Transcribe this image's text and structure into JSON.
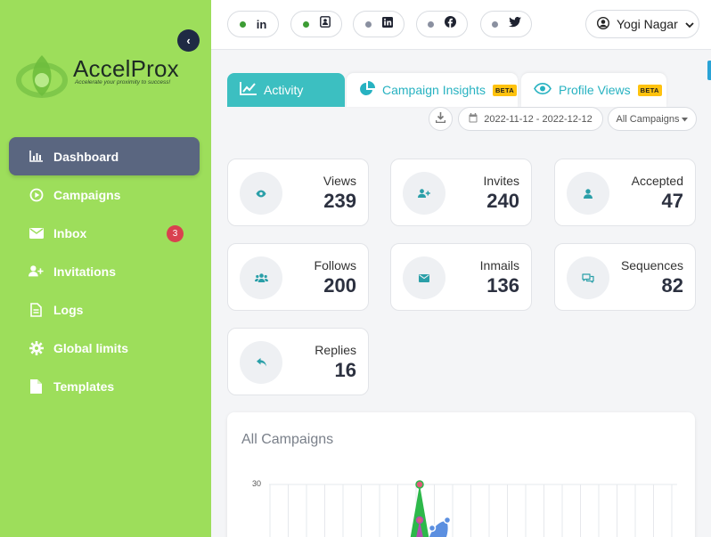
{
  "sidebar": {
    "brand": {
      "name": "AccelProx",
      "tagline": "Accelerate your proximity to success!"
    },
    "items": [
      {
        "label": "Dashboard",
        "icon": "bar-chart-icon",
        "active": true
      },
      {
        "label": "Campaigns",
        "icon": "play-circle-icon"
      },
      {
        "label": "Inbox",
        "icon": "envelope-icon",
        "badge": "3"
      },
      {
        "label": "Invitations",
        "icon": "user-plus-icon"
      },
      {
        "label": "Logs",
        "icon": "file-icon"
      },
      {
        "label": "Global limits",
        "icon": "gear-icon"
      },
      {
        "label": "Templates",
        "icon": "document-icon"
      }
    ]
  },
  "topbar": {
    "accounts": [
      {
        "icon": "linkedin-text-icon",
        "status": "#3c9c34"
      },
      {
        "icon": "contact-card-icon",
        "status": "#3c9c34"
      },
      {
        "icon": "linkedin-square-icon",
        "status": "#8a90a0"
      },
      {
        "icon": "facebook-icon",
        "status": "#8a90a0"
      },
      {
        "icon": "twitter-icon",
        "status": "#8a90a0"
      }
    ],
    "user": {
      "name": "Yogi Nagar"
    }
  },
  "tabs": [
    {
      "label": "Activity",
      "active": true
    },
    {
      "label": "Campaign Insights",
      "badge": "BETA"
    },
    {
      "label": "Profile Views",
      "badge": "BETA"
    }
  ],
  "filters": {
    "date_range": "2022-11-12 - 2022-12-12",
    "campaign": "All Campaigns"
  },
  "stats": [
    {
      "label": "Views",
      "value": "239",
      "icon": "eye-icon"
    },
    {
      "label": "Invites",
      "value": "240",
      "icon": "user-plus-icon"
    },
    {
      "label": "Accepted",
      "value": "47",
      "icon": "user-icon"
    },
    {
      "label": "Follows",
      "value": "200",
      "icon": "users-icon"
    },
    {
      "label": "Inmails",
      "value": "136",
      "icon": "envelope-icon"
    },
    {
      "label": "Sequences",
      "value": "82",
      "icon": "chat-icon"
    },
    {
      "label": "Replies",
      "value": "16",
      "icon": "reply-icon"
    }
  ],
  "chart": {
    "title": "All Campaigns",
    "y_tick": "30"
  },
  "colors": {
    "sidebar": "#9dde5b",
    "accent": "#3cbfc1",
    "active_nav": "#5a6680",
    "badge": "#d9414f",
    "beta": "#ffc20e"
  }
}
